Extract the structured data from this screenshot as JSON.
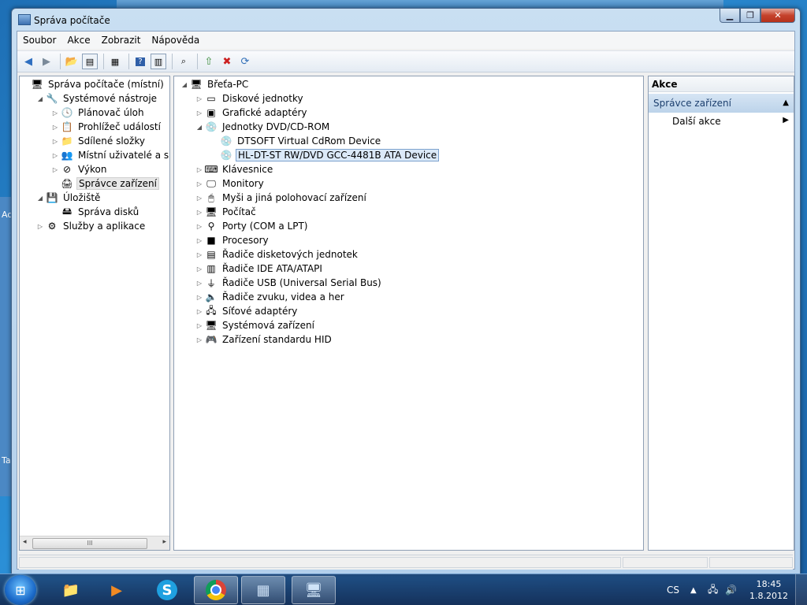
{
  "window": {
    "title": "Správa počítače",
    "buttons": {
      "minimize": "▁",
      "maximize": "❐",
      "close": "✕"
    }
  },
  "menu": [
    "Soubor",
    "Akce",
    "Zobrazit",
    "Nápověda"
  ],
  "background": {
    "left_chars": [
      "Ad",
      "Ta"
    ]
  },
  "left_tree": [
    {
      "label": "Správa počítače (místní)",
      "icon": "computer-management-icon",
      "glyph": "🖥",
      "expand": "",
      "indent": 0
    },
    {
      "label": "Systémové nástroje",
      "icon": "tools-icon",
      "glyph": "🔧",
      "expand": "◢",
      "indent": 1
    },
    {
      "label": "Plánovač úloh",
      "icon": "clock-icon",
      "glyph": "🕓",
      "expand": "▷",
      "indent": 2
    },
    {
      "label": "Prohlížeč událostí",
      "icon": "event-viewer-icon",
      "glyph": "📋",
      "expand": "▷",
      "indent": 2
    },
    {
      "label": "Sdílené složky",
      "icon": "shared-folder-icon",
      "glyph": "📁",
      "expand": "▷",
      "indent": 2
    },
    {
      "label": "Místní uživatelé a skupiny",
      "icon": "users-icon",
      "glyph": "👥",
      "expand": "▷",
      "indent": 2
    },
    {
      "label": "Výkon",
      "icon": "no-entry-icon",
      "glyph": "⊘",
      "expand": "▷",
      "indent": 2
    },
    {
      "label": "Správce zařízení",
      "icon": "device-manager-icon",
      "glyph": "🖨",
      "expand": "",
      "indent": 2,
      "selected": true
    },
    {
      "label": "Úložiště",
      "icon": "storage-icon",
      "glyph": "💾",
      "expand": "◢",
      "indent": 1
    },
    {
      "label": "Správa disků",
      "icon": "disk-icon",
      "glyph": "🖴",
      "expand": "",
      "indent": 2
    },
    {
      "label": "Služby a aplikace",
      "icon": "services-icon",
      "glyph": "⚙",
      "expand": "▷",
      "indent": 1
    }
  ],
  "device_tree": [
    {
      "label": "Břeťa-PC",
      "icon": "pc-icon",
      "glyph": "🖥",
      "expand": "◢",
      "indent": 0
    },
    {
      "label": "Diskové jednotky",
      "icon": "disk-drive-icon",
      "glyph": "▭",
      "expand": "▷",
      "indent": 1
    },
    {
      "label": "Grafické adaptéry",
      "icon": "display-adapter-icon",
      "glyph": "▣",
      "expand": "▷",
      "indent": 1
    },
    {
      "label": "Jednotky DVD/CD-ROM",
      "icon": "dvd-drive-icon",
      "glyph": "💿",
      "expand": "◢",
      "indent": 1
    },
    {
      "label": "DTSOFT Virtual CdRom Device",
      "icon": "dvd-device-icon",
      "glyph": "💿",
      "expand": "",
      "indent": 2
    },
    {
      "label": "HL-DT-ST RW/DVD GCC-4481B ATA Device",
      "icon": "dvd-device-icon",
      "glyph": "💿",
      "expand": "",
      "indent": 2,
      "selected": true
    },
    {
      "label": "Klávesnice",
      "icon": "keyboard-icon",
      "glyph": "⌨",
      "expand": "▷",
      "indent": 1
    },
    {
      "label": "Monitory",
      "icon": "monitor-icon",
      "glyph": "🖵",
      "expand": "▷",
      "indent": 1
    },
    {
      "label": "Myši a jiná polohovací zařízení",
      "icon": "mouse-icon",
      "glyph": "🖱",
      "expand": "▷",
      "indent": 1
    },
    {
      "label": "Počítač",
      "icon": "computer-icon",
      "glyph": "🖥",
      "expand": "▷",
      "indent": 1
    },
    {
      "label": "Porty (COM a LPT)",
      "icon": "port-icon",
      "glyph": "⚲",
      "expand": "▷",
      "indent": 1
    },
    {
      "label": "Procesory",
      "icon": "processor-icon",
      "glyph": "■",
      "expand": "▷",
      "indent": 1
    },
    {
      "label": "Řadiče disketových jednotek",
      "icon": "floppy-controller-icon",
      "glyph": "▤",
      "expand": "▷",
      "indent": 1
    },
    {
      "label": "Řadiče IDE ATA/ATAPI",
      "icon": "ide-controller-icon",
      "glyph": "▥",
      "expand": "▷",
      "indent": 1
    },
    {
      "label": "Řadiče USB (Universal Serial Bus)",
      "icon": "usb-icon",
      "glyph": "⏚",
      "expand": "▷",
      "indent": 1
    },
    {
      "label": "Řadiče zvuku, videa a her",
      "icon": "sound-icon",
      "glyph": "🔈",
      "expand": "▷",
      "indent": 1
    },
    {
      "label": "Síťové adaptéry",
      "icon": "network-adapter-icon",
      "glyph": "🖧",
      "expand": "▷",
      "indent": 1
    },
    {
      "label": "Systémová zařízení",
      "icon": "system-device-icon",
      "glyph": "🖥",
      "expand": "▷",
      "indent": 1
    },
    {
      "label": "Zařízení standardu HID",
      "icon": "hid-icon",
      "glyph": "🎮",
      "expand": "▷",
      "indent": 1
    }
  ],
  "actions": {
    "header": "Akce",
    "section": "Správce zařízení",
    "item": "Další akce"
  },
  "scrollbar": {
    "left": "◂",
    "right": "▸",
    "grip": "III"
  },
  "taskbar": {
    "language": "CS",
    "time": "18:45",
    "date": "1.8.2012"
  }
}
